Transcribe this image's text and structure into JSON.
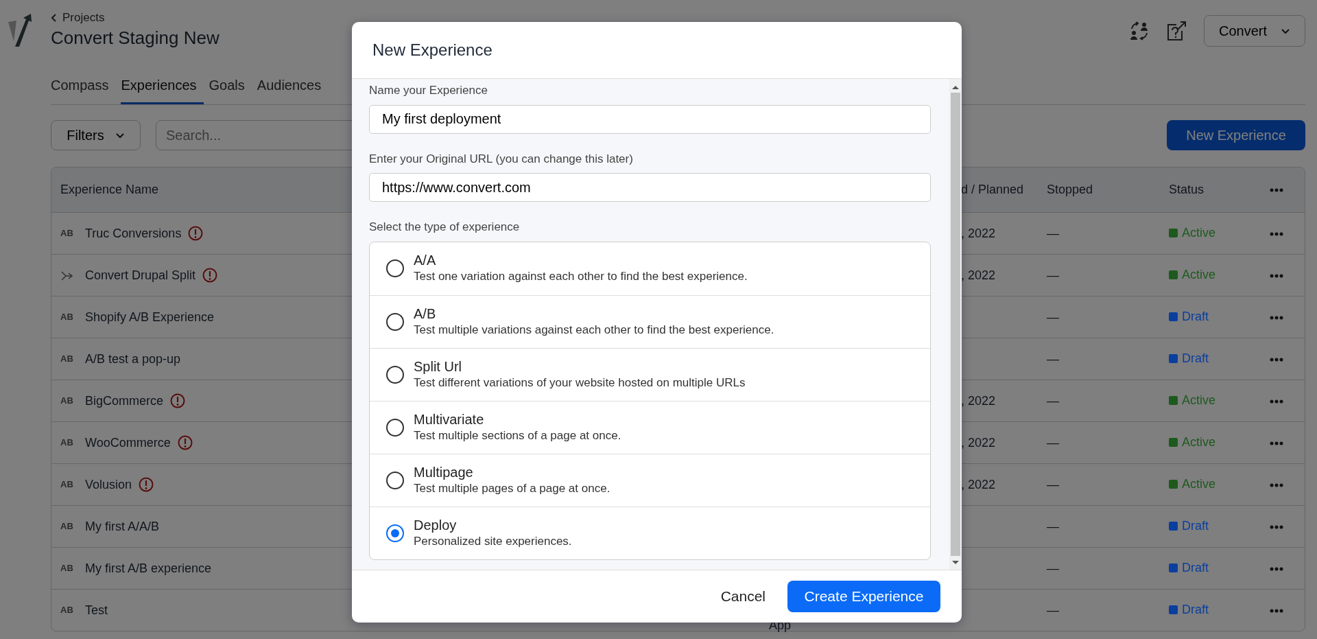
{
  "header": {
    "back_link": "Projects",
    "title": "Convert Staging New",
    "account_menu": "Convert"
  },
  "tabs": [
    {
      "label": "Compass",
      "selected": false
    },
    {
      "label": "Experiences",
      "selected": true
    },
    {
      "label": "Goals",
      "selected": false
    },
    {
      "label": "Audiences",
      "selected": false
    }
  ],
  "toolbar": {
    "filters": "Filters",
    "search_placeholder": "Search...",
    "new_button": "New Experience"
  },
  "table": {
    "columns": [
      "Experience Name",
      "d / Planned",
      "Stopped",
      "Status"
    ],
    "rows": [
      {
        "kind": "ab",
        "type_label": "AB",
        "name": "Truc Conversions",
        "warning": true,
        "planned": ", 2022",
        "stopped": "—",
        "status": "Active",
        "color": "#1e5a1e"
      },
      {
        "kind": "split",
        "name": "Convert Drupal Split",
        "warning": true,
        "planned": ", 2022",
        "stopped": "—",
        "status": "Active",
        "color": "#1e5a1e"
      },
      {
        "kind": "ab",
        "type_label": "AB",
        "name": "Shopify A/B Experience",
        "warning": false,
        "stopped": "—",
        "status": "Draft",
        "color": "#0b3f9e"
      },
      {
        "kind": "ab",
        "type_label": "AB",
        "name": "A/B test a pop-up",
        "warning": false,
        "stopped": "—",
        "status": "Draft",
        "color": "#0b3f9e"
      },
      {
        "kind": "ab",
        "type_label": "AB",
        "name": "BigCommerce",
        "warning": true,
        "planned": ", 2022",
        "stopped": "—",
        "status": "Active",
        "color": "#1e5a1e"
      },
      {
        "kind": "ab",
        "type_label": "AB",
        "name": "WooCommerce",
        "warning": true,
        "planned": ", 2022",
        "stopped": "—",
        "status": "Active",
        "color": "#1e5a1e"
      },
      {
        "kind": "ab",
        "type_label": "AB",
        "name": "Volusion",
        "warning": true,
        "planned": ", 2022",
        "stopped": "—",
        "status": "Active",
        "color": "#1e5a1e"
      },
      {
        "kind": "ab",
        "type_label": "AB",
        "name": "My first A/A/B",
        "warning": false,
        "stopped": "—",
        "status": "Draft",
        "color": "#0b3f9e"
      },
      {
        "kind": "ab",
        "type_label": "AB",
        "name": "My first A/B experience",
        "warning": false,
        "stopped": "—",
        "status": "Draft",
        "color": "#0b3f9e"
      },
      {
        "kind": "ab",
        "type_label": "AB",
        "name": "Test",
        "warning": false,
        "column_2": "App",
        "stopped": "—",
        "status": "Draft",
        "color": "#0b3f9e"
      }
    ]
  },
  "modal": {
    "title": "New Experience",
    "fields": [
      {
        "label": "Name your Experience",
        "value": "My first deployment"
      },
      {
        "label": "Enter your Original URL (you can change this later)",
        "value": "https://www.convert.com"
      }
    ],
    "type_label": "Select the type of experience",
    "options": [
      {
        "title": "A/A",
        "description": "Test one variation against each other to find the best experience.",
        "selected": false
      },
      {
        "title": "A/B",
        "description": "Test multiple variations against each other to find the best experience.",
        "selected": false
      },
      {
        "title": "Split Url",
        "description": "Test different variations of your website hosted on multiple URLs",
        "selected": false
      },
      {
        "title": "Multivariate",
        "description": "Test multiple sections of a page at once.",
        "selected": false
      },
      {
        "title": "Multipage",
        "description": "Test multiple pages of a page at once.",
        "selected": false
      },
      {
        "title": "Deploy",
        "description": "Personalized site experiences.",
        "selected": true
      }
    ],
    "cancel": "Cancel",
    "create": "Create Experience"
  }
}
